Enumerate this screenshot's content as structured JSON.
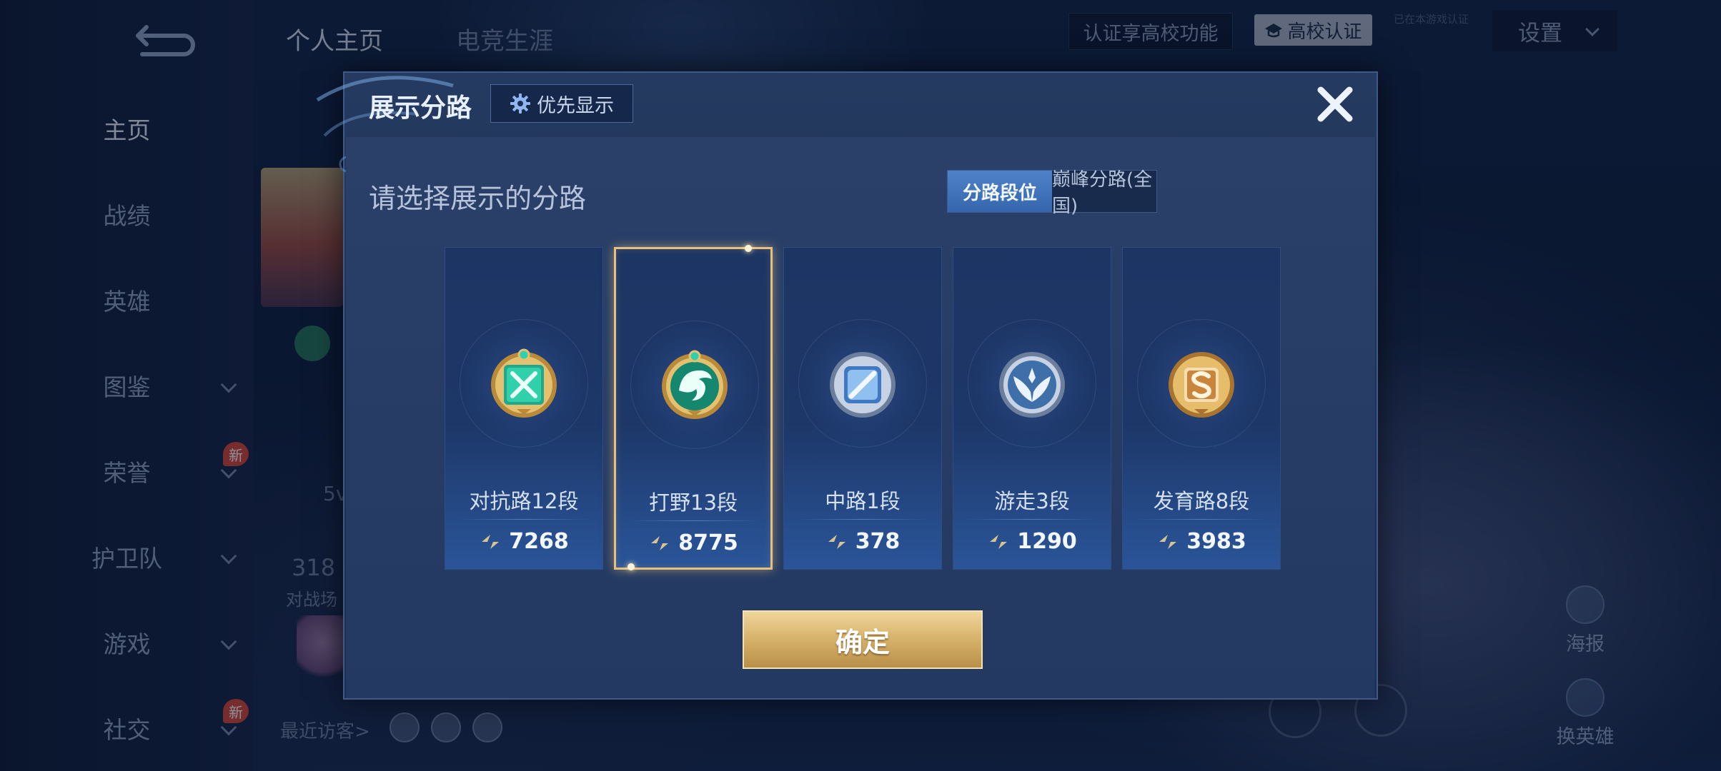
{
  "sidebar": {
    "items": [
      {
        "label": "主页",
        "active": true
      },
      {
        "label": "战绩"
      },
      {
        "label": "英雄"
      },
      {
        "label": "图鉴",
        "chevron": true
      },
      {
        "label": "荣誉",
        "chevron": true,
        "badge": "新"
      },
      {
        "label": "护卫队",
        "chevron": true
      },
      {
        "label": "游戏",
        "chevron": true
      },
      {
        "label": "社交",
        "chevron": true,
        "badge": "新"
      }
    ]
  },
  "top_tabs": [
    {
      "label": "个人主页",
      "active": true
    },
    {
      "label": "电竞生涯"
    }
  ],
  "top_right": {
    "cert_text": "认证享高校功能",
    "school_cert_label": "高校认证",
    "hint_text": "已在本游戏认证",
    "settings_label": "设置"
  },
  "background": {
    "fragment_1": "5v",
    "fragment_2": "318",
    "fragment_3": "对战场",
    "visitors_label": "最近访客>",
    "poster_label": "海报",
    "swap_hero_label": "换英雄"
  },
  "dialog": {
    "title": "展示分路",
    "priority_label": "优先显示",
    "section_title": "请选择展示的分路",
    "tabs": [
      {
        "label": "分路段位",
        "active": true
      },
      {
        "label": "巅峰分路(全国)"
      }
    ],
    "lanes": [
      {
        "rank": "对抗路12段",
        "score": "7268",
        "emblem": "clash-lane-emblem-icon"
      },
      {
        "rank": "打野13段",
        "score": "8775",
        "emblem": "jungle-emblem-icon",
        "selected": true
      },
      {
        "rank": "中路1段",
        "score": "378",
        "emblem": "mid-lane-emblem-icon"
      },
      {
        "rank": "游走3段",
        "score": "1290",
        "emblem": "roam-emblem-icon"
      },
      {
        "rank": "发育路8段",
        "score": "3983",
        "emblem": "farm-lane-emblem-icon"
      }
    ],
    "confirm_label": "确定"
  },
  "colors": {
    "accent_gold": "#e6c07f",
    "tab_active_blue": "#3f73bb",
    "badge_red": "#d4453a"
  }
}
